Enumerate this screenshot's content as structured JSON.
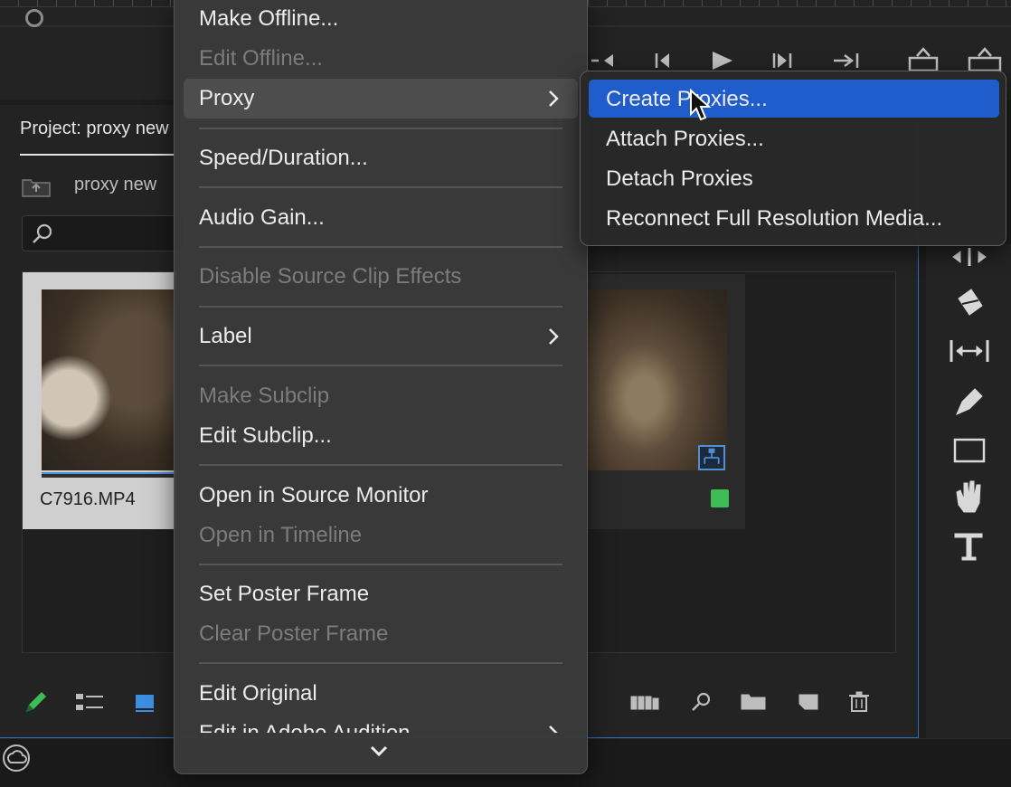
{
  "project_panel": {
    "tab_title": "Project: proxy new",
    "bin_name": "proxy new",
    "clip_1_name": "C7916.MP4"
  },
  "context_menu": {
    "items": [
      {
        "label": "Make Offline...",
        "enabled": true
      },
      {
        "label": "Edit Offline...",
        "enabled": false
      },
      {
        "label": "Proxy",
        "enabled": true,
        "submenu": true,
        "highlighted": true
      },
      {
        "label": "Speed/Duration...",
        "enabled": true
      },
      {
        "label": "Audio Gain...",
        "enabled": true
      },
      {
        "label": "Disable Source Clip Effects",
        "enabled": false
      },
      {
        "label": "Label",
        "enabled": true,
        "submenu": true
      },
      {
        "label": "Make Subclip",
        "enabled": false
      },
      {
        "label": "Edit Subclip...",
        "enabled": true
      },
      {
        "label": "Open in Source Monitor",
        "enabled": true
      },
      {
        "label": "Open in Timeline",
        "enabled": false
      },
      {
        "label": "Set Poster Frame",
        "enabled": true
      },
      {
        "label": "Clear Poster Frame",
        "enabled": false
      },
      {
        "label": "Edit Original",
        "enabled": true
      },
      {
        "label": "Edit in Adobe Audition",
        "enabled": true,
        "submenu": true
      }
    ]
  },
  "proxy_submenu": {
    "items": [
      {
        "label": "Create Proxies...",
        "highlighted": true
      },
      {
        "label": "Attach Proxies..."
      },
      {
        "label": "Detach Proxies"
      },
      {
        "label": "Reconnect Full Resolution Media..."
      }
    ]
  },
  "colors": {
    "menu_highlight": "#1f5ccc",
    "panel_focus_border": "#2f6fb5",
    "label_green": "#3dbb55"
  }
}
